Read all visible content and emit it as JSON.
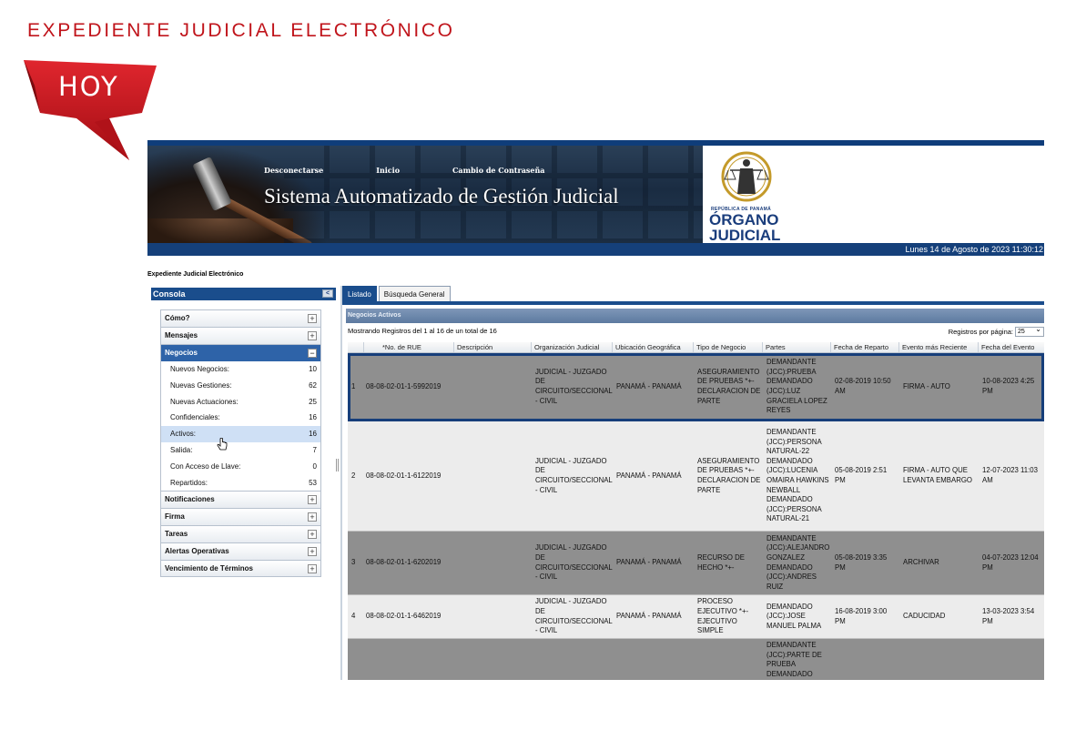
{
  "header": {
    "title": "EXPEDIENTE JUDICIAL ELECTRÓNICO",
    "badge": "HOY"
  },
  "banner": {
    "links": [
      "Desconectarse",
      "Inicio",
      "Cambio de Contraseña"
    ],
    "title": "Sistema Automatizado de Gestión Judicial",
    "logo": {
      "small": "REPÚBLICA DE PANAMÁ",
      "line1": "ÓRGANO",
      "line2": "JUDICIAL"
    },
    "date": "Lunes 14 de Agosto de 2023 11:30:12"
  },
  "breadcrumb": "Expediente Judicial Electrónico",
  "console": {
    "title": "Consola",
    "collapse": "<"
  },
  "sidebar": {
    "top": [
      "Cómo?",
      "Mensajes"
    ],
    "open": "Negocios",
    "items": [
      {
        "label": "Nuevos Negocios:",
        "count": "10"
      },
      {
        "label": "Nuevas Gestiones:",
        "count": "62"
      },
      {
        "label": "Nuevas Actuaciones:",
        "count": "25"
      },
      {
        "label": "Confidenciales:",
        "count": "16"
      },
      {
        "label": "Activos:",
        "count": "16"
      },
      {
        "label": "Salida:",
        "count": "7"
      },
      {
        "label": "Con Acceso de Llave:",
        "count": "0"
      },
      {
        "label": "Repartidos:",
        "count": "53"
      }
    ],
    "bottom": [
      "Notificaciones",
      "Firma",
      "Tareas",
      "Alertas Operativas",
      "Vencimiento de Términos"
    ],
    "plus": "+",
    "minus": "−"
  },
  "tabs": [
    "Listado",
    "Búsqueda General"
  ],
  "panel": {
    "title": "Negocios Activos",
    "showing": "Mostrando Registros del 1 al 16 de un total de 16",
    "per_page_label": "Registros por página:",
    "per_page_value": "25"
  },
  "table": {
    "headers": [
      "",
      "*No. de RUE",
      "Descripción",
      "Organización Judicial",
      "Ubicación Geográfica",
      "Tipo de Negocio",
      "Partes",
      "Fecha de Reparto",
      "Evento más Reciente",
      "Fecha del Evento"
    ],
    "rows": [
      [
        "1",
        "08-08-02-01-1-5992019",
        "",
        "JUDICIAL - JUZGADO DE CIRCUITO/SECCIONAL - CIVIL",
        "PANAMÁ - PANAMÁ",
        "ASEGURAMIENTO DE PRUEBAS *+- DECLARACION DE PARTE",
        "DEMANDANTE (JCC):PRUEBA DEMANDADO (JCC):LUZ GRACIELA LOPEZ REYES",
        "02-08-2019 10:50 AM",
        "FIRMA - AUTO",
        "10-08-2023 4:25 PM"
      ],
      [
        "2",
        "08-08-02-01-1-6122019",
        "",
        "JUDICIAL - JUZGADO DE CIRCUITO/SECCIONAL - CIVIL",
        "PANAMÁ - PANAMÁ",
        "ASEGURAMIENTO DE PRUEBAS *+- DECLARACION DE PARTE",
        "DEMANDANTE (JCC):PERSONA NATURAL-22 DEMANDADO (JCC):LUCENIA OMAIRA HAWKINS NEWBALL DEMANDADO (JCC):PERSONA NATURAL-21",
        "05-08-2019 2:51 PM",
        "FIRMA - AUTO QUE LEVANTA EMBARGO",
        "12-07-2023 11:03 AM"
      ],
      [
        "3",
        "08-08-02-01-1-6202019",
        "",
        "JUDICIAL - JUZGADO DE CIRCUITO/SECCIONAL - CIVIL",
        "PANAMÁ - PANAMÁ",
        "RECURSO DE HECHO *+-",
        "DEMANDANTE (JCC):ALEJANDRO GONZALEZ DEMANDADO (JCC):ANDRES RUIZ",
        "05-08-2019 3:35 PM",
        "ARCHIVAR",
        "04-07-2023 12:04 PM"
      ],
      [
        "4",
        "08-08-02-01-1-6462019",
        "",
        "JUDICIAL - JUZGADO DE CIRCUITO/SECCIONAL - CIVIL",
        "PANAMÁ - PANAMÁ",
        "PROCESO EJECUTIVO *+- EJECUTIVO SIMPLE",
        "DEMANDADO (JCC):JOSE MANUEL PALMA",
        "16-08-2019 3:00 PM",
        "CADUCIDAD",
        "13-03-2023 3:54 PM"
      ],
      [
        "",
        "",
        "",
        "",
        "",
        "",
        "DEMANDANTE (JCC):PARTE DE PRUEBA DEMANDADO",
        "",
        "",
        ""
      ]
    ]
  },
  "colors": {
    "accent_red": "#c0141b",
    "brand_blue": "#1a4d8c",
    "dark_row": "#8f8f8f",
    "light_row": "#ececec"
  }
}
